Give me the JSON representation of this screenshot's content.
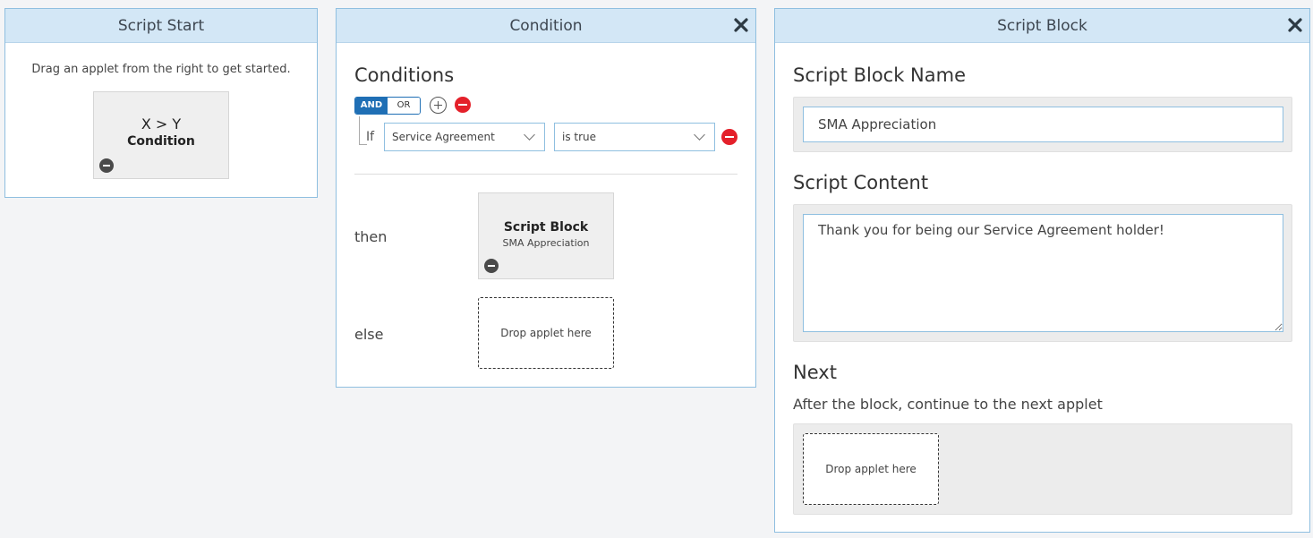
{
  "script_start": {
    "title": "Script Start",
    "hint": "Drag an applet from the right to get started.",
    "applet": {
      "symbol": "X > Y",
      "label": "Condition"
    }
  },
  "condition_panel": {
    "title": "Condition",
    "heading": "Conditions",
    "toggle": {
      "and_label": "AND",
      "or_label": "OR",
      "selected": "AND"
    },
    "if_label": "If",
    "field_select": {
      "value": "Service Agreement"
    },
    "operator_select": {
      "value": "is true"
    },
    "then_label": "then",
    "then_applet": {
      "title": "Script Block",
      "subtitle": "SMA Appreciation"
    },
    "else_label": "else",
    "else_drop": "Drop applet here"
  },
  "script_block_panel": {
    "title": "Script Block",
    "name_heading": "Script Block Name",
    "name_value": "SMA Appreciation",
    "content_heading": "Script Content",
    "content_value": "Thank you for being our Service Agreement holder!",
    "next_heading": "Next",
    "next_description": "After the block, continue to the next applet",
    "next_drop": "Drop applet here"
  },
  "colors": {
    "header_bg": "#d3e7f6",
    "panel_border": "#8fbfe0",
    "toggle_active": "#1f6fb5",
    "remove_red": "#e4202a",
    "page_bg": "#f3f4f6"
  },
  "icons": {
    "close": "close-icon",
    "remove": "minus-circle-icon",
    "add": "plus-circle-icon",
    "dropdown": "chevron-down-icon"
  }
}
